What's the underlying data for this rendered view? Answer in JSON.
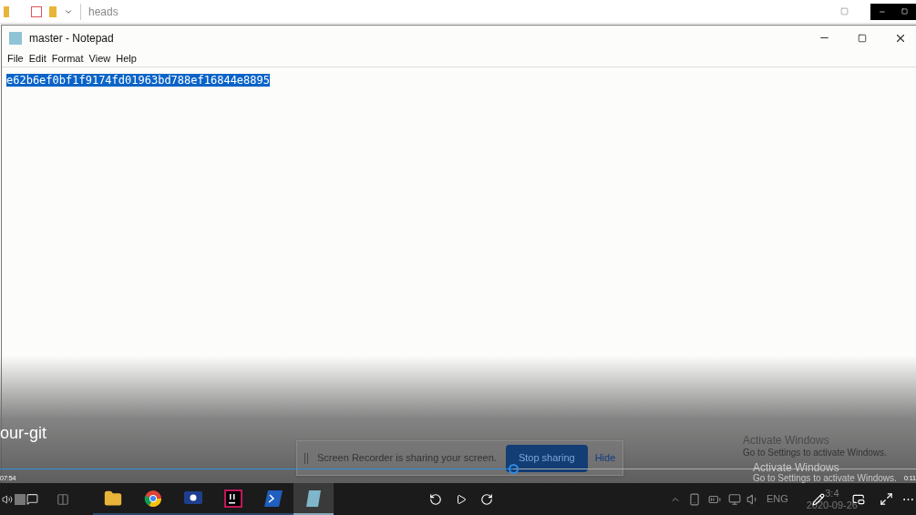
{
  "explorer_bar": {
    "path": "heads"
  },
  "notepad": {
    "title": "master - Notepad",
    "menu": [
      "File",
      "Edit",
      "Format",
      "View",
      "Help"
    ],
    "text": "e62b6ef0bf1f9174fd01963bd788ef16844e8895",
    "text_selected": true
  },
  "player": {
    "title": "our-git",
    "elapsed": "07:54",
    "remaining": "0:11",
    "seek": {
      "level": 0.56
    }
  },
  "recorder_bar": {
    "message": "Screen Recorder is sharing your screen.",
    "buttons": [
      "Stop sharing",
      "Hide"
    ]
  },
  "watermarks": [
    {
      "title": "Activate Windows",
      "subtitle": "Go to Settings to activate Windows."
    },
    {
      "title": "Activate Windows",
      "subtitle": "Go to Settings to activate Windows."
    }
  ],
  "taskbar": {
    "apps": [
      {
        "kind": "folder",
        "active": false
      },
      {
        "kind": "browser",
        "active": false
      },
      {
        "kind": "recorder",
        "active": false
      },
      {
        "kind": "ide",
        "active": false
      },
      {
        "kind": "shell",
        "active": false
      },
      {
        "kind": "notepad",
        "active": true
      }
    ],
    "language": "ENG",
    "time": "3:4",
    "date": "2020-09-26",
    "more": "⋯"
  }
}
